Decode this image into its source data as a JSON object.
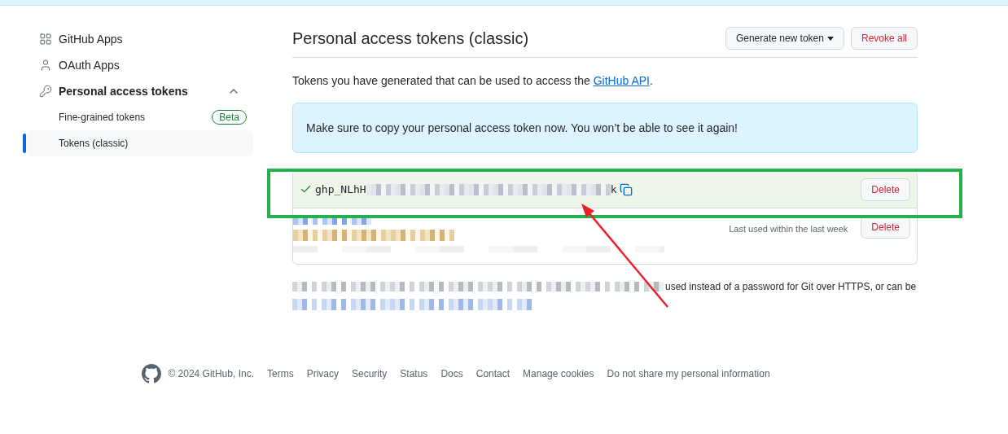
{
  "sidebar": {
    "items": [
      {
        "label": "GitHub Apps",
        "kind": "apps"
      },
      {
        "label": "OAuth Apps",
        "kind": "person"
      },
      {
        "label": "Personal access tokens",
        "kind": "key",
        "expanded": true,
        "children": [
          {
            "label": "Fine-grained tokens",
            "badge": "Beta",
            "selected": false
          },
          {
            "label": "Tokens (classic)",
            "selected": true
          }
        ]
      }
    ]
  },
  "header": {
    "title": "Personal access tokens (classic)",
    "buttons": [
      {
        "label": "Generate new token",
        "kind": "dropdown"
      },
      {
        "label": "Revoke all",
        "kind": "danger"
      }
    ]
  },
  "intro": {
    "text": "Tokens you have generated that can be used to access the ",
    "link": "GitHub API",
    "suffix": "."
  },
  "flash": "Make sure to copy your personal access token now. You won’t be able to see it again!",
  "tokens": [
    {
      "kind": "new",
      "prefix": "ghp_NLhH",
      "suffix": "k",
      "action": "Delete"
    },
    {
      "kind": "existing",
      "last_used": "Last used within the last week",
      "action": "Delete"
    }
  ],
  "note": "used instead of a password for Git over HTTPS, or can be",
  "footer": {
    "copyright": "© 2024 GitHub, Inc.",
    "links": [
      "Terms",
      "Privacy",
      "Security",
      "Status",
      "Docs",
      "Contact",
      "Manage cookies",
      "Do not share my personal information"
    ]
  }
}
